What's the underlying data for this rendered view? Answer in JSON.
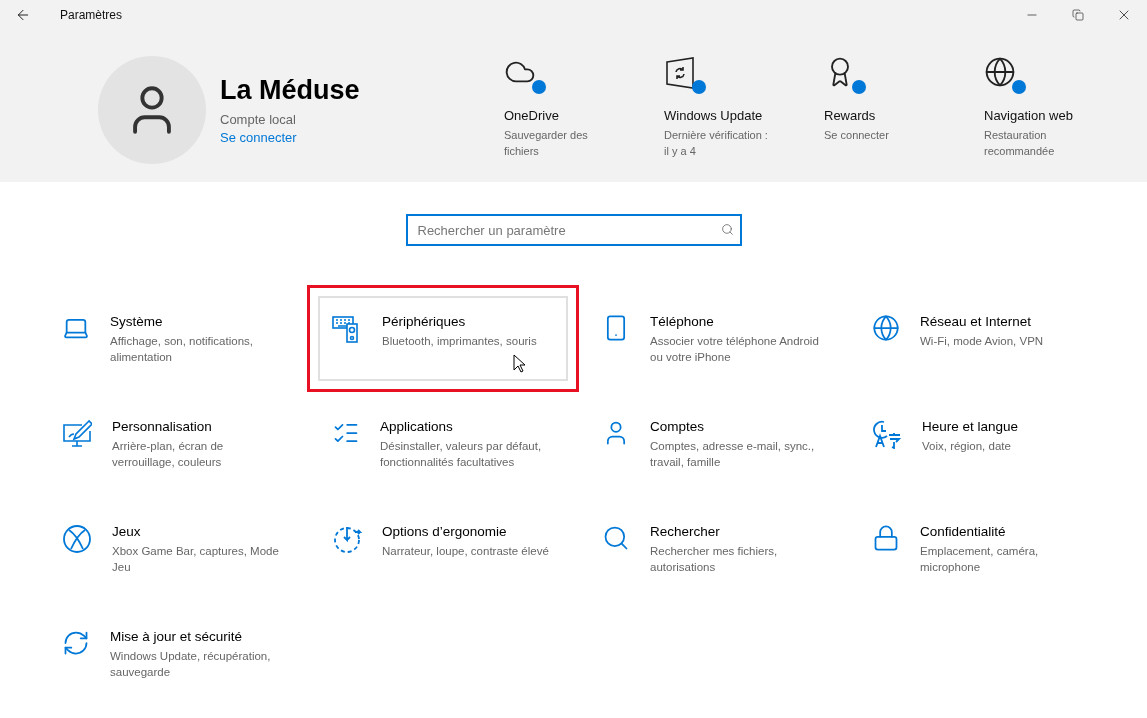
{
  "window": {
    "title": "Paramètres"
  },
  "account": {
    "name": "La Méduse",
    "type": "Compte local",
    "link": "Se connecter"
  },
  "shortcuts": [
    {
      "title": "OneDrive",
      "subtitle": "Sauvegarder des fichiers"
    },
    {
      "title": "Windows Update",
      "subtitle": "Dernière vérification : il y a 4"
    },
    {
      "title": "Rewards",
      "subtitle": "Se connecter"
    },
    {
      "title": "Navigation web",
      "subtitle": "Restauration recommandée"
    }
  ],
  "search": {
    "placeholder": "Rechercher un paramètre"
  },
  "categories": [
    {
      "title": "Système",
      "subtitle": "Affichage, son, notifications, alimentation",
      "hovered": false,
      "highlighted": false
    },
    {
      "title": "Périphériques",
      "subtitle": "Bluetooth, imprimantes, souris",
      "hovered": true,
      "highlighted": true
    },
    {
      "title": "Téléphone",
      "subtitle": "Associer votre téléphone Android ou votre iPhone",
      "hovered": false,
      "highlighted": false
    },
    {
      "title": "Réseau et Internet",
      "subtitle": "Wi-Fi, mode Avion, VPN",
      "hovered": false,
      "highlighted": false
    },
    {
      "title": "Personnalisation",
      "subtitle": "Arrière-plan, écran de verrouillage, couleurs",
      "hovered": false,
      "highlighted": false
    },
    {
      "title": "Applications",
      "subtitle": "Désinstaller, valeurs par défaut, fonctionnalités facultatives",
      "hovered": false,
      "highlighted": false
    },
    {
      "title": "Comptes",
      "subtitle": "Comptes, adresse e-mail, sync., travail, famille",
      "hovered": false,
      "highlighted": false
    },
    {
      "title": "Heure et langue",
      "subtitle": "Voix, région, date",
      "hovered": false,
      "highlighted": false
    },
    {
      "title": "Jeux",
      "subtitle": "Xbox Game Bar, captures, Mode Jeu",
      "hovered": false,
      "highlighted": false
    },
    {
      "title": "Options d’ergonomie",
      "subtitle": "Narrateur, loupe, contraste élevé",
      "hovered": false,
      "highlighted": false
    },
    {
      "title": "Rechercher",
      "subtitle": "Rechercher mes fichiers, autorisations",
      "hovered": false,
      "highlighted": false
    },
    {
      "title": "Confidentialité",
      "subtitle": "Emplacement, caméra, microphone",
      "hovered": false,
      "highlighted": false
    },
    {
      "title": "Mise à jour et sécurité",
      "subtitle": "Windows Update, récupération, sauvegarde",
      "hovered": false,
      "highlighted": false
    }
  ]
}
